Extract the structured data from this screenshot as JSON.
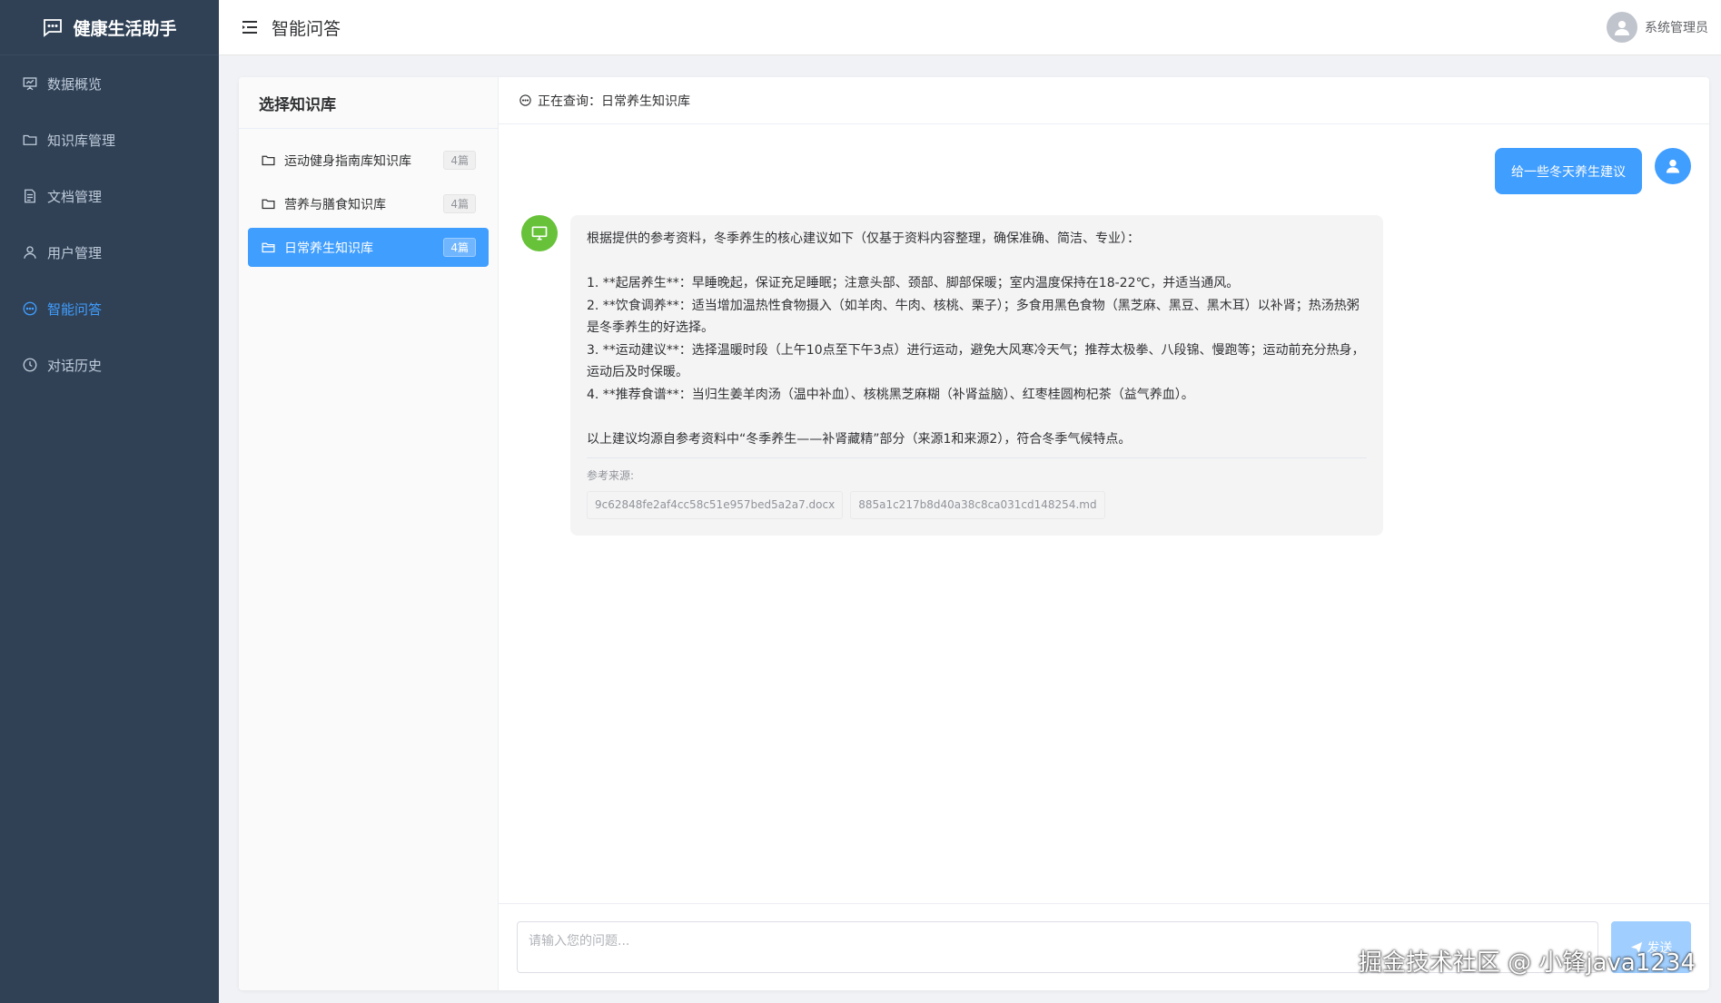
{
  "sidebar": {
    "brand": "健康生活助手",
    "items": [
      {
        "label": "数据概览",
        "icon": "presentation-icon"
      },
      {
        "label": "知识库管理",
        "icon": "folder-icon"
      },
      {
        "label": "文档管理",
        "icon": "document-icon"
      },
      {
        "label": "用户管理",
        "icon": "user-icon"
      },
      {
        "label": "智能问答",
        "icon": "chat-icon",
        "active": true
      },
      {
        "label": "对话历史",
        "icon": "clock-icon"
      }
    ],
    "colors": {
      "background": "#304156",
      "text": "#bfcbd9",
      "active": "#409eff"
    }
  },
  "header": {
    "title": "智能问答",
    "user_name": "系统管理员"
  },
  "kb_panel": {
    "title": "选择知识库",
    "items": [
      {
        "name": "运动健身指南库知识库",
        "count": "4篇"
      },
      {
        "name": "营养与膳食知识库",
        "count": "4篇"
      },
      {
        "name": "日常养生知识库",
        "count": "4篇",
        "active": true
      }
    ]
  },
  "chat": {
    "querying_prefix": "正在查询：",
    "querying_kb": "日常养生知识库",
    "user_message": "给一些冬天养生建议",
    "bot_lines": [
      "根据提供的参考资料，冬季养生的核心建议如下（仅基于资料内容整理，确保准确、简洁、专业）：",
      "",
      "1. **起居养生**：早睡晚起，保证充足睡眠；注意头部、颈部、脚部保暖；室内温度保持在18-22℃，并适当通风。",
      "2. **饮食调养**：适当增加温热性食物摄入（如羊肉、牛肉、核桃、栗子）；多食用黑色食物（黑芝麻、黑豆、黑木耳）以补肾；热汤热粥是冬季养生的好选择。",
      "3. **运动建议**：选择温暖时段（上午10点至下午3点）进行运动，避免大风寒冷天气；推荐太极拳、八段锦、慢跑等；运动前充分热身，运动后及时保暖。",
      "4. **推荐食谱**：当归生姜羊肉汤（温中补血）、核桃黑芝麻糊（补肾益脑）、红枣桂圆枸杞茶（益气养血）。",
      "",
      "以上建议均源自参考资料中“冬季养生——补肾藏精”部分（来源1和来源2），符合冬季气候特点。"
    ],
    "refs_label": "参考来源:",
    "refs": [
      "9c62848fe2af4cc58c51e957bed5a2a7.docx",
      "885a1c217b8d40a38c8ca031cd148254.md"
    ],
    "input_placeholder": "请输入您的问题...",
    "send_label": "发送"
  },
  "watermark": "掘金技术社区 @ 小锋java1234",
  "colors": {
    "primary": "#409eff",
    "bot_avatar": "#67c23a"
  }
}
